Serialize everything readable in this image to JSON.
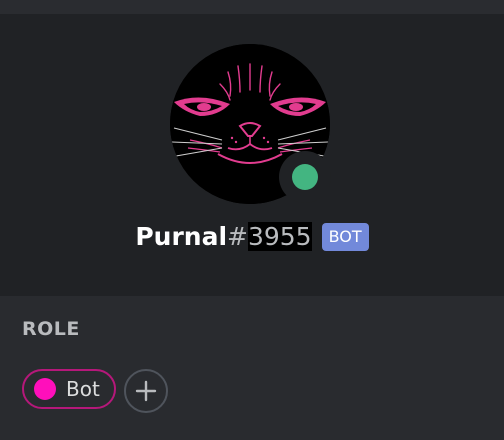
{
  "user": {
    "username": "Purnal",
    "discriminator_hash": "#",
    "discriminator_digits": "3955",
    "bot_tag": "BOT",
    "status": "online",
    "status_color": "#43b581"
  },
  "roles": {
    "title": "ROLE",
    "items": [
      {
        "label": "Bot",
        "color": "#ff0fbb"
      }
    ],
    "add_icon": "plus-icon"
  },
  "colors": {
    "header_bg": "#202225",
    "body_bg": "#292b2f",
    "bot_tag_bg": "#7289da"
  }
}
